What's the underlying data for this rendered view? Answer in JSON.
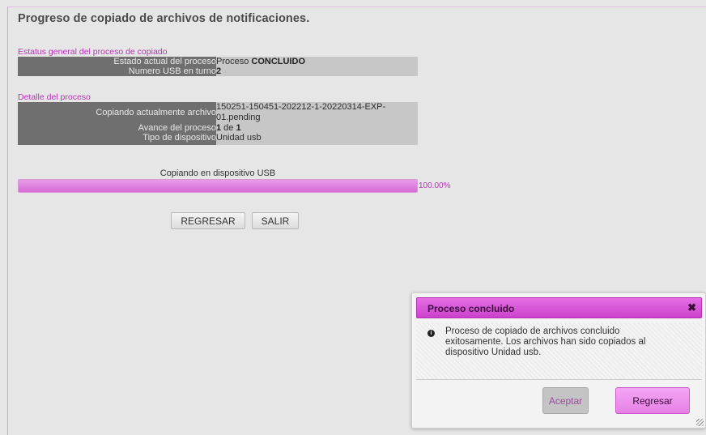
{
  "page": {
    "title": "Progreso de copiado de archivos de notificaciones."
  },
  "status_section": {
    "label": "Estatus general del proceso de copiado",
    "rows": [
      {
        "key": "Estado actual del proceso",
        "value_prefix": "Proceso ",
        "value_bold": "CONCLUIDO"
      },
      {
        "key": "Numero USB en turno",
        "value_bold": "2"
      }
    ]
  },
  "detail_section": {
    "label": "Detalle del proceso",
    "rows": [
      {
        "key": "Copiando actualmente archivo",
        "value": "150251-150451-202212-1-20220314-EXP-01.pending"
      },
      {
        "key": "Avance del proceso",
        "value_a": "1",
        "value_mid": " de ",
        "value_b": "1"
      },
      {
        "key": "Tipo de dispositivo",
        "value": "Unidad usb"
      }
    ]
  },
  "progress": {
    "caption": "Copiando en dispositivo USB",
    "percent_text": "100.00%",
    "fraction": 1.0
  },
  "buttons": {
    "regresar": "REGRESAR",
    "salir": "SALIR"
  },
  "dialog": {
    "title": "Proceso concluido",
    "close_glyph": "✖",
    "info_glyph": "i",
    "message": "Proceso de copiado de archivos concluido exitosamente. Los archivos han sido copiados al dispositivo Unidad usb.",
    "accept_label": "Aceptar",
    "back_label": "Regresar"
  },
  "colors": {
    "accent": "#d66bd6",
    "label_text": "#b534b5"
  }
}
